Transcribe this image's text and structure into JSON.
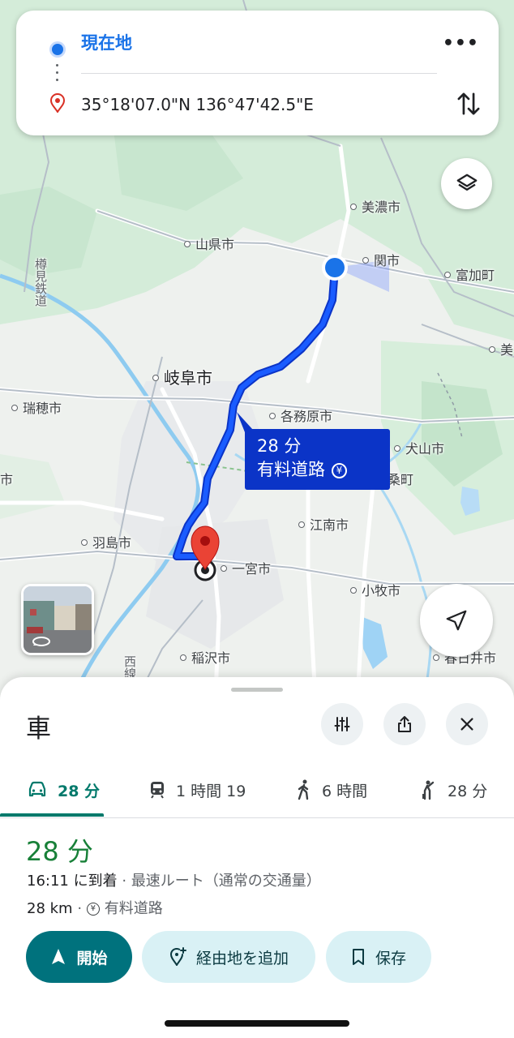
{
  "directions": {
    "origin": "現在地",
    "destination": "35°18'07.0\"N 136°47'42.5\"E",
    "more_icon": "more-horiz-icon",
    "swap_icon": "swap-vert-icon"
  },
  "map": {
    "route_color": "#1a44e8",
    "callout": {
      "time": "28 分",
      "note": "有料道路"
    },
    "labels": {
      "minokamo": "美濃市",
      "seki": "関市",
      "tomika": "富加町",
      "mino_edge": "美",
      "yamagata": "山県市",
      "tarumi": "樽見鉄道",
      "gifu": "岐阜市",
      "mizuho": "瑞穂市",
      "kakamigahara": "各務原市",
      "inuyama": "犬山市",
      "fuso": "桑町",
      "edge_shi": "市",
      "konan": "江南市",
      "hashima": "羽島市",
      "ichinomiya": "一宮市",
      "komaki": "小牧市",
      "inazawa": "稲沢市",
      "kasugai": "春日井市",
      "nishi": "西線"
    }
  },
  "sheet": {
    "title": "車",
    "tabs": [
      {
        "icon": "car-icon",
        "label": "28 分"
      },
      {
        "icon": "train-icon",
        "label": "1 時間 19"
      },
      {
        "icon": "walk-icon",
        "label": "6 時間"
      },
      {
        "icon": "ride-hail-icon",
        "label": "28 分"
      }
    ],
    "duration": "28 分",
    "arrival": "16:11 に到着",
    "route_desc": "最速ルート（通常の交通量）",
    "distance": "28 km",
    "toll": "有料道路",
    "separator": "·",
    "buttons": {
      "start": "開始",
      "add_stop": "経由地を追加",
      "save": "保存"
    }
  },
  "colors": {
    "accent_teal": "#00727d",
    "duration_green": "#188038",
    "origin_blue": "#1a73e8",
    "pin_red": "#d93025"
  }
}
